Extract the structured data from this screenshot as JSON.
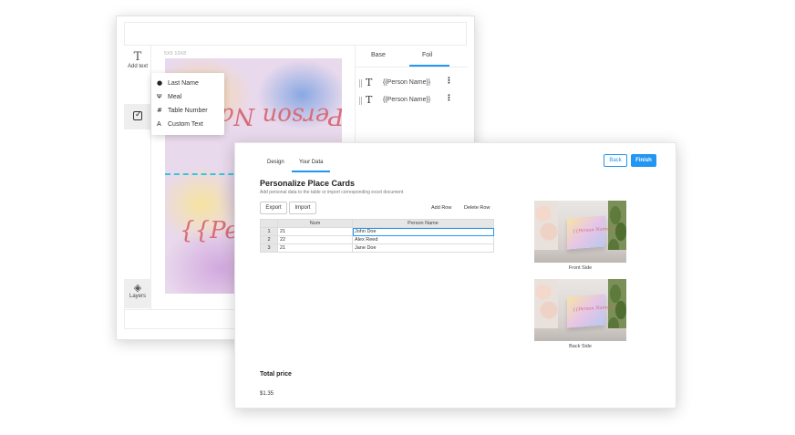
{
  "editor": {
    "tools": {
      "add_text_label": "Add text",
      "layers_label": "Layers"
    },
    "size_label": "5X5 10X8",
    "canvas": {
      "top_text": "{{Person Na",
      "bottom_text": "{{Person"
    },
    "dropdown": [
      {
        "icon": "person-icon",
        "glyph": "👤",
        "label": "Last Name"
      },
      {
        "icon": "utensils-icon",
        "glyph": "ᛏ",
        "label": "Meal"
      },
      {
        "icon": "hash-icon",
        "glyph": "#",
        "label": "Table Number"
      },
      {
        "icon": "text-icon",
        "glyph": "A",
        "label": "Custom Text"
      }
    ],
    "panel": {
      "tabs": [
        "Base",
        "Foil"
      ],
      "active_tab": "Foil",
      "layers": [
        "{{Person Name}}",
        "{{Person Name}}"
      ]
    }
  },
  "data_window": {
    "tabs": [
      "Design",
      "Your Data"
    ],
    "active_tab": "Your Data",
    "back_label": "Back",
    "finish_label": "Finish",
    "title": "Personalize Place Cards",
    "subtitle": "Add personal data to the table or import corresponding excel document",
    "export_label": "Export",
    "import_label": "Import",
    "add_row_label": "Add Row",
    "delete_row_label": "Delete Row",
    "table": {
      "columns": [
        "Num",
        "Person Name"
      ],
      "rows": [
        {
          "n": "1",
          "num": "21",
          "name": "John Doe"
        },
        {
          "n": "2",
          "num": "22",
          "name": "Alex Reed"
        },
        {
          "n": "3",
          "num": "21",
          "name": "Jane Doe"
        }
      ]
    },
    "previews": {
      "front_label": "Front Side",
      "back_label": "Back Side",
      "card_text": "{{Person Name}}"
    },
    "total_price_label": "Total price",
    "total_price_value": "$1.35",
    "accent_color": "#2196f3"
  }
}
